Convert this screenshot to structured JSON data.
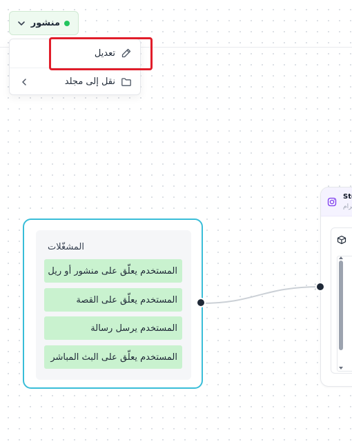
{
  "status": {
    "label": "منشور",
    "dot_color": "#22c55e",
    "icon": "chevron-down-icon"
  },
  "menu": {
    "items": [
      {
        "label": "تعديل",
        "icon": "pencil-icon"
      },
      {
        "label": "نقل إلى مجلد",
        "icon": "folder-icon",
        "submenu_icon": "chevron-left-icon"
      }
    ]
  },
  "trigger_node": {
    "title": "المشغّلات",
    "items": [
      "المستخدم يعلّق على منشور أو ريل",
      "المستخدم يعلّق على القصة",
      "المستخدم يرسل رسالة",
      "المستخدم يعلّق على البث المباشر"
    ],
    "accent": "#38bdd8",
    "item_bg": "#c9f2cf"
  },
  "right_node": {
    "title": "Ste",
    "subtitle": "غرام",
    "icon": "instagram-icon",
    "panel_icon": "cube-icon"
  },
  "colors": {
    "highlight": "#e11d2a",
    "edge": "#cbd0d6"
  }
}
